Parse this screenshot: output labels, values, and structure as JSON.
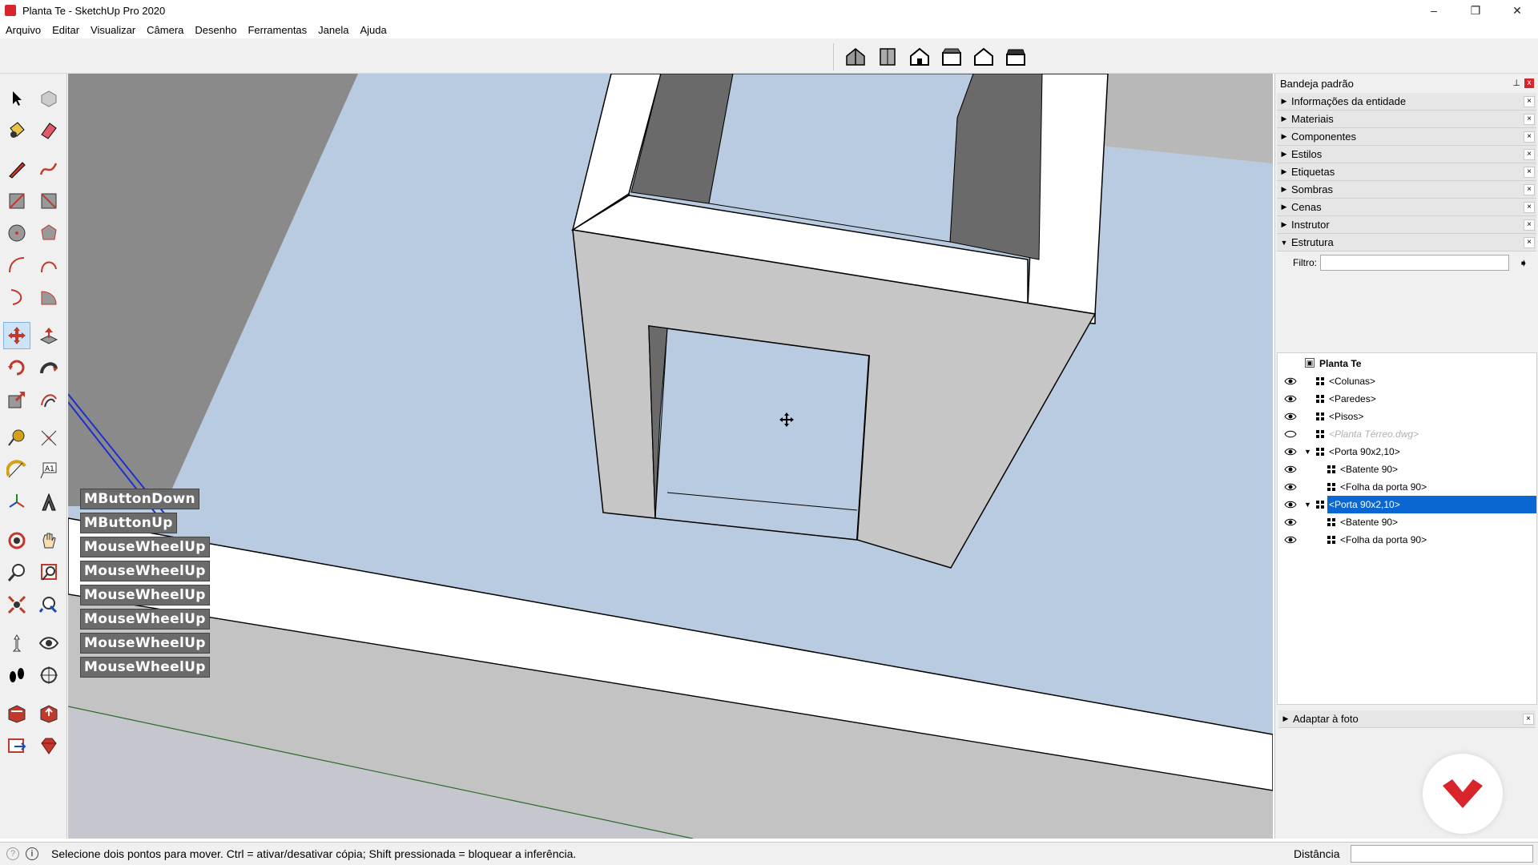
{
  "window": {
    "title": "Planta Te - SketchUp Pro 2020",
    "minimize": "–",
    "restore": "❐",
    "close": "✕"
  },
  "menu": [
    "Arquivo",
    "Editar",
    "Visualizar",
    "Câmera",
    "Desenho",
    "Ferramentas",
    "Janela",
    "Ajuda"
  ],
  "views_toolbar": {
    "buttons": [
      "iso-view-icon",
      "top-view-icon",
      "front-view-icon",
      "right-view-icon",
      "back-view-icon",
      "left-view-icon"
    ]
  },
  "tools": [
    "select-arrow-icon",
    "make-component-icon",
    "paint-bucket-icon",
    "eraser-icon",
    "line-pencil-icon",
    "freehand-icon",
    "rectangle-icon",
    "rotated-rectangle-icon",
    "circle-icon",
    "polygon-icon",
    "arc-icon",
    "two-point-arc-icon",
    "three-point-arc-icon",
    "pie-icon",
    "move-icon",
    "push-pull-icon",
    "rotate-icon",
    "follow-me-icon",
    "scale-icon",
    "offset-icon",
    "tape-measure-icon",
    "dimension-icon",
    "protractor-icon",
    "text-icon",
    "axes-icon",
    "3d-text-icon",
    "orbit-icon",
    "pan-icon",
    "zoom-icon",
    "zoom-window-icon",
    "zoom-extents-icon",
    "previous-view-icon",
    "position-camera-icon",
    "look-around-icon",
    "walk-icon",
    "section-plane-icon",
    "warehouse-icon",
    "share-model-icon",
    "extension-warehouse-icon",
    "ruby-icon"
  ],
  "overlay_keys": [
    "MButtonDown",
    "MButtonUp",
    "MouseWheelUp",
    "MouseWheelUp",
    "MouseWheelUp",
    "MouseWheelUp",
    "MouseWheelUp",
    "MouseWheelUp"
  ],
  "tray": {
    "title": "Bandeja padrão",
    "pin": "📌",
    "close": "x",
    "panels": [
      {
        "label": "Informações da entidade",
        "expanded": false
      },
      {
        "label": "Materiais",
        "expanded": false
      },
      {
        "label": "Componentes",
        "expanded": false
      },
      {
        "label": "Estilos",
        "expanded": false
      },
      {
        "label": "Etiquetas",
        "expanded": false
      },
      {
        "label": "Sombras",
        "expanded": false
      },
      {
        "label": "Cenas",
        "expanded": false
      },
      {
        "label": "Instrutor",
        "expanded": false
      },
      {
        "label": "Estrutura",
        "expanded": true
      }
    ],
    "filter_label": "Filtro:",
    "filter_value": "",
    "outliner": {
      "root": "Planta Te",
      "items": [
        {
          "label": "<Colunas>",
          "visible": true,
          "level": 1,
          "expandable": false,
          "selected": false
        },
        {
          "label": "<Paredes>",
          "visible": true,
          "level": 1,
          "expandable": false,
          "selected": false
        },
        {
          "label": "<Pisos>",
          "visible": true,
          "level": 1,
          "expandable": false,
          "selected": false
        },
        {
          "label": "<Planta Térreo.dwg>",
          "visible": false,
          "level": 1,
          "expandable": false,
          "selected": false
        },
        {
          "label": "<Porta 90x2,10>",
          "visible": true,
          "level": 1,
          "expandable": true,
          "selected": false
        },
        {
          "label": "<Batente 90>",
          "visible": true,
          "level": 2,
          "expandable": false,
          "selected": false
        },
        {
          "label": "<Folha da porta 90>",
          "visible": true,
          "level": 2,
          "expandable": false,
          "selected": false
        },
        {
          "label": "<Porta 90x2,10>",
          "visible": true,
          "level": 1,
          "expandable": true,
          "selected": true
        },
        {
          "label": "<Batente 90>",
          "visible": true,
          "level": 2,
          "expandable": false,
          "selected": false
        },
        {
          "label": "<Folha da porta 90>",
          "visible": true,
          "level": 2,
          "expandable": false,
          "selected": false
        }
      ]
    },
    "bottom_panel": "Adaptar à foto"
  },
  "status": {
    "message": "Selecione dois pontos para mover. Ctrl = ativar/desativar cópia; Shift pressionada = bloquear a inferência.",
    "measurement_label": "Distância",
    "measurement_value": ""
  },
  "colors": {
    "sky": "#b9cbe0",
    "selection": "#0a66d0",
    "brand_red": "#d9242b"
  }
}
